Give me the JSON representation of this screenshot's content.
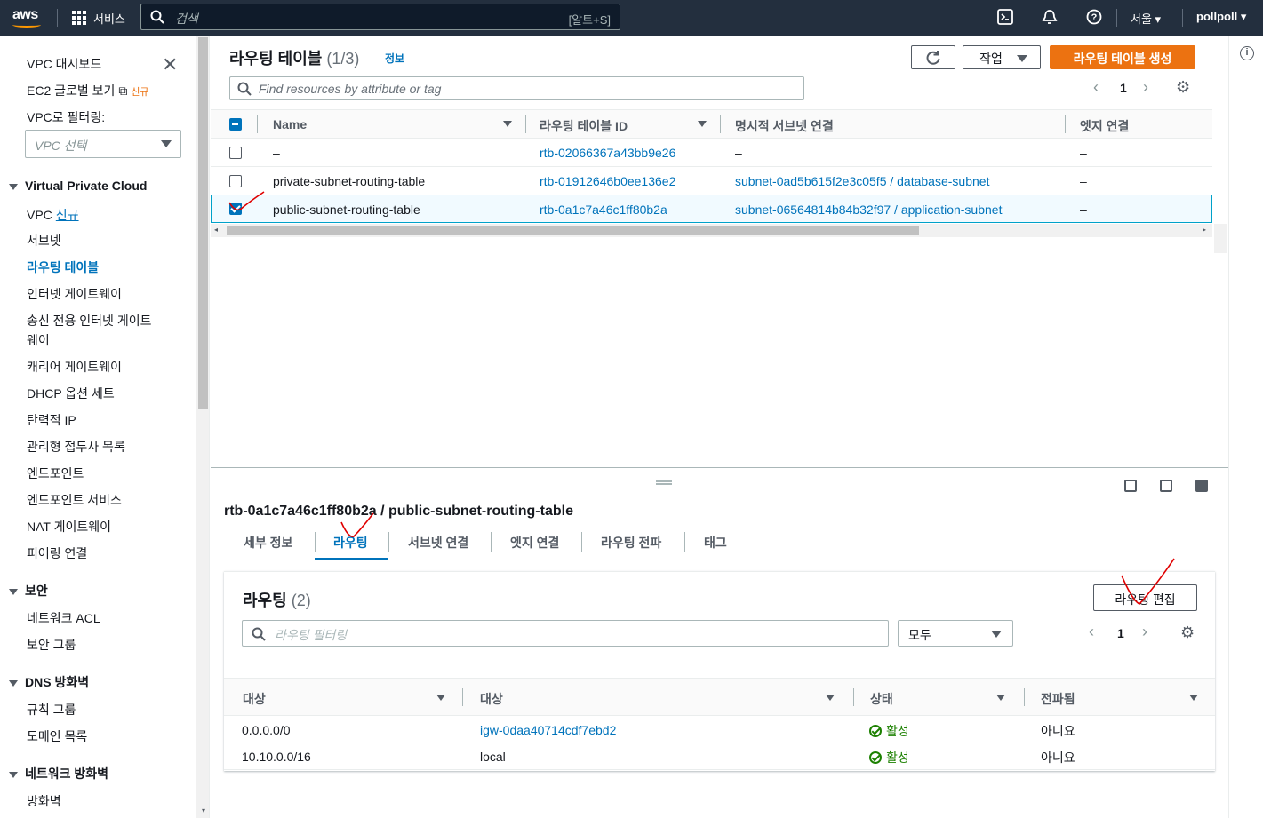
{
  "topbar": {
    "logo": "aws",
    "services_label": "서비스",
    "search_placeholder": "검색",
    "search_shortcut": "[알트+S]",
    "region_label": "서울",
    "user_label": "pollpoll",
    "icons": [
      "cloudshell-icon",
      "bell-icon",
      "help-icon"
    ]
  },
  "sidebar": {
    "dashboard": "VPC 대시보드",
    "ec2_global": "EC2 글로벌 보기",
    "ec2_new_badge": "신규",
    "filter_label": "VPC로 필터링:",
    "filter_placeholder": "VPC 선택",
    "sections": [
      {
        "title": "Virtual Private Cloud",
        "items": [
          "VPC",
          "서브넷",
          "라우팅 테이블",
          "인터넷 게이트웨이",
          "송신 전용 인터넷 게이트",
          "웨이",
          "캐리어 게이트웨이",
          "DHCP 옵션 세트",
          "탄력적 IP",
          "관리형 접두사 목록",
          "엔드포인트",
          "엔드포인트 서비스",
          "NAT 게이트웨이",
          "피어링 연결"
        ]
      },
      {
        "title": "보안",
        "items": [
          "네트워크 ACL",
          "보안 그룹"
        ]
      },
      {
        "title": "DNS 방화벽",
        "items": [
          "규칙 그룹",
          "도메인 목록"
        ]
      },
      {
        "title": "네트워크 방화벽",
        "items": [
          "방화벽"
        ]
      }
    ],
    "vpc_new": "신규",
    "active_item": "라우팅 테이블"
  },
  "header": {
    "title": "라우팅 테이블",
    "count": "(1/3)",
    "info_link": "정보",
    "actions_label": "작업",
    "create_label": "라우팅 테이블 생성",
    "filter_placeholder": "Find resources by attribute or tag",
    "page": "1"
  },
  "table": {
    "columns": [
      "Name",
      "라우팅 테이블 ID",
      "명시적 서브넷 연결",
      "엣지 연결"
    ],
    "rows": [
      {
        "name": "–",
        "id": "rtb-02066367a43bb9e26",
        "subnet": "–",
        "edge": "–",
        "checked": false
      },
      {
        "name": "private-subnet-routing-table",
        "id": "rtb-01912646b0ee136e2",
        "subnet": "subnet-0ad5b615f2e3c05f5 / database-subnet",
        "edge": "–",
        "checked": false
      },
      {
        "name": "public-subnet-routing-table",
        "id": "rtb-0a1c7a46c1ff80b2a",
        "subnet": "subnet-06564814b84b32f97 / application-subnet",
        "edge": "–",
        "checked": true
      }
    ]
  },
  "detail": {
    "title": "rtb-0a1c7a46c1ff80b2a / public-subnet-routing-table",
    "tabs": [
      "세부 정보",
      "라우팅",
      "서브넷 연결",
      "엣지 연결",
      "라우팅 전파",
      "태그"
    ],
    "active_tab": "라우팅",
    "routes_title": "라우팅",
    "routes_count": "(2)",
    "edit_routes_label": "라우팅 편집",
    "routes_filter_placeholder": "라우팅 필터링",
    "routes_select_value": "모두",
    "page": "1",
    "columns": [
      "대상",
      "대상",
      "상태",
      "전파됨"
    ],
    "routes": [
      {
        "destination": "0.0.0.0/0",
        "target": "igw-0daa40714cdf7ebd2",
        "status": "활성",
        "propagated": "아니요"
      },
      {
        "destination": "10.10.0.0/16",
        "target": "local",
        "status": "활성",
        "propagated": "아니요"
      }
    ]
  },
  "colors": {
    "topbar": "#232f3e",
    "accent": "#0073bb",
    "primary": "#ec7211",
    "success": "#1d8102",
    "annotation": "#e00000"
  }
}
